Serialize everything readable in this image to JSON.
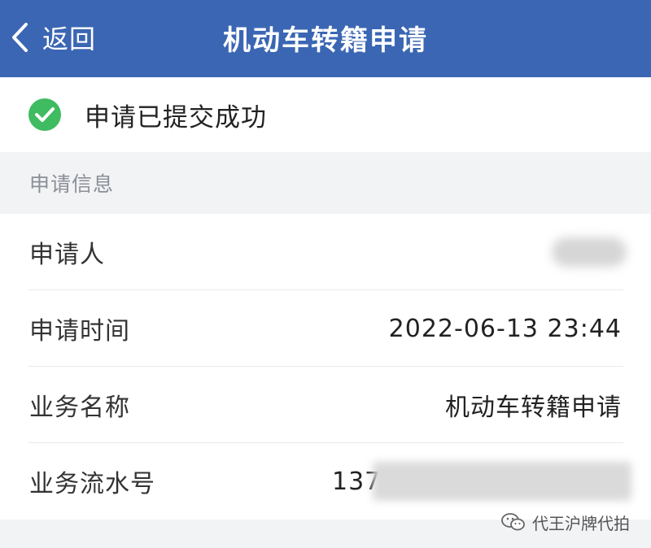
{
  "navbar": {
    "back_label": "返回",
    "title": "机动车转籍申请",
    "background": "#3b66b3"
  },
  "status": {
    "icon": "check-circle-icon",
    "text": "申请已提交成功",
    "icon_color": "#3fbb61"
  },
  "section": {
    "header": "申请信息"
  },
  "rows": [
    {
      "label": "申请人",
      "value": ""
    },
    {
      "label": "申请时间",
      "value": "2022-06-13 23:44"
    },
    {
      "label": "业务名称",
      "value": "机动车转籍申请"
    },
    {
      "label": "业务流水号",
      "value": "137"
    }
  ],
  "watermark": {
    "icon": "wechat-icon",
    "text": "代王沪牌代拍"
  }
}
